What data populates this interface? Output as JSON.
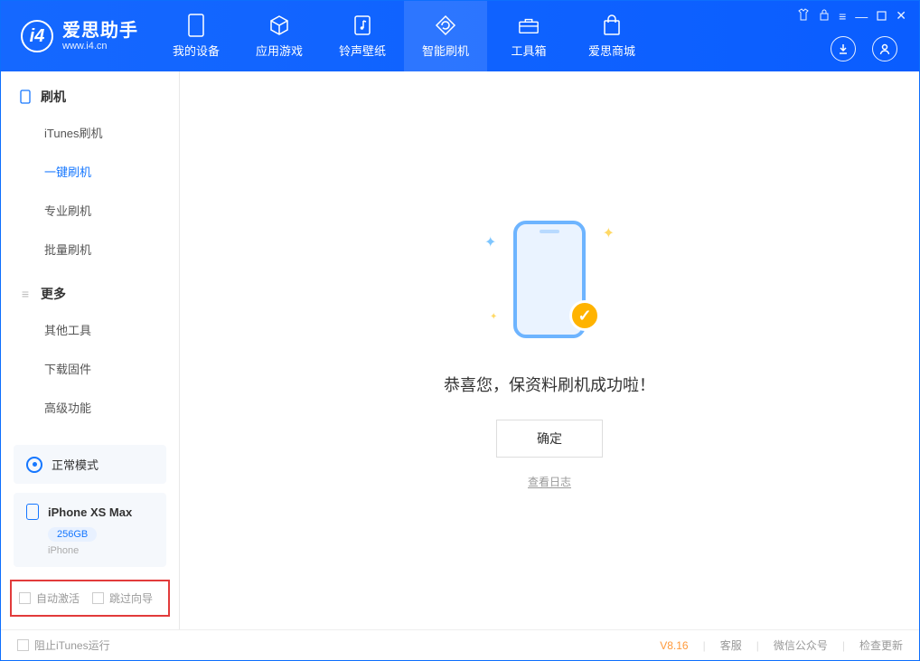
{
  "app": {
    "name": "爱思助手",
    "url": "www.i4.cn"
  },
  "nav": {
    "items": [
      {
        "label": "我的设备",
        "icon": "device-icon"
      },
      {
        "label": "应用游戏",
        "icon": "cube-icon"
      },
      {
        "label": "铃声壁纸",
        "icon": "music-icon"
      },
      {
        "label": "智能刷机",
        "icon": "refresh-icon"
      },
      {
        "label": "工具箱",
        "icon": "toolbox-icon"
      },
      {
        "label": "爱思商城",
        "icon": "store-icon"
      }
    ],
    "active_index": 3
  },
  "sidebar": {
    "group1": {
      "title": "刷机",
      "items": [
        "iTunes刷机",
        "一键刷机",
        "专业刷机",
        "批量刷机"
      ],
      "active_index": 1
    },
    "group2": {
      "title": "更多",
      "items": [
        "其他工具",
        "下载固件",
        "高级功能"
      ]
    },
    "status": {
      "label": "正常模式"
    },
    "device": {
      "name": "iPhone XS Max",
      "capacity": "256GB",
      "type": "iPhone"
    },
    "checks": {
      "auto_activate": "自动激活",
      "skip_guide": "跳过向导"
    }
  },
  "main": {
    "success_msg": "恭喜您，保资料刷机成功啦！",
    "ok_button": "确定",
    "view_log": "查看日志"
  },
  "footer": {
    "block_itunes": "阻止iTunes运行",
    "version": "V8.16",
    "links": [
      "客服",
      "微信公众号",
      "检查更新"
    ]
  },
  "colors": {
    "primary": "#1568ff",
    "accent": "#ffb300",
    "highlight_border": "#e23b3b"
  }
}
